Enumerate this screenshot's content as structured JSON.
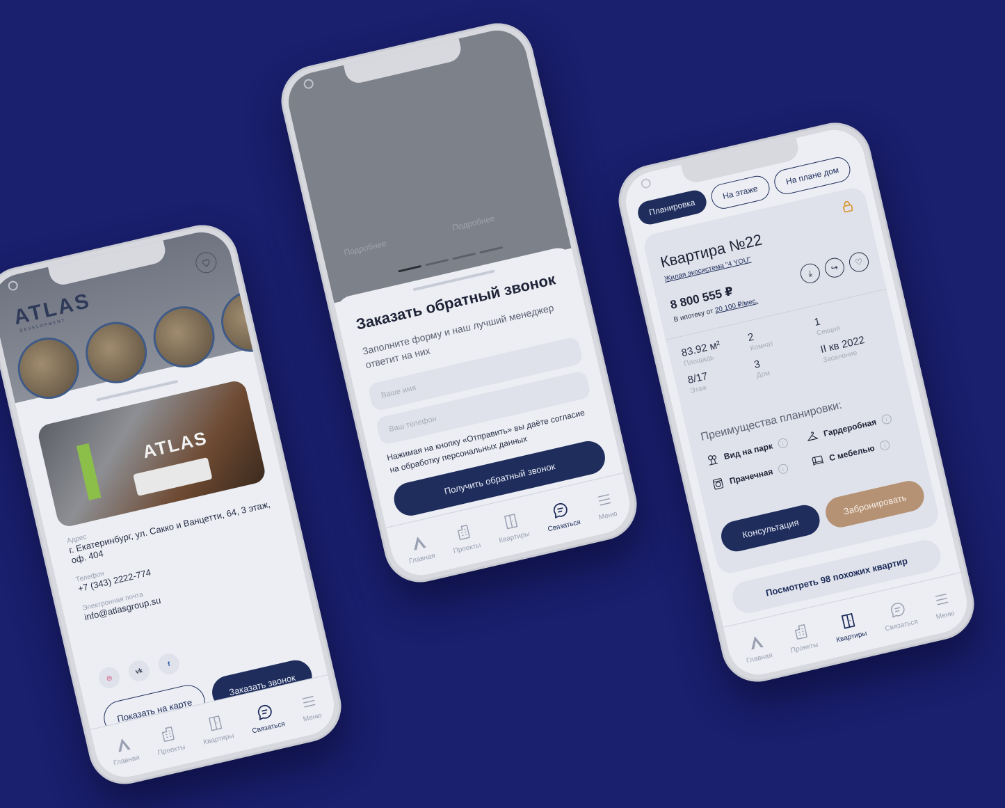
{
  "nav": {
    "home": "Главная",
    "projects": "Проекты",
    "apartments": "Квартиры",
    "contact": "Связаться",
    "menu": "Меню"
  },
  "phone1": {
    "logo": "ATLAS",
    "logo_sub": "DEVELOPMENT",
    "photo_sign": "ATLAS",
    "address_label": "Адрес",
    "address_value": "г. Екатеринбург, ул. Сакко и Ванцетти, 64, 3 этаж, оф. 404",
    "phone_label": "Телефон",
    "phone_value": "+7 (343) 2222-774",
    "email_label": "Электронная почта",
    "email_value": "info@atlasgroup.su",
    "socials": [
      "instagram-icon",
      "vk-icon",
      "facebook-icon"
    ],
    "show_map": "Показать на карте",
    "order_call": "Заказать звонок"
  },
  "phone2": {
    "more1": "Подробнее",
    "more2": "Подробнее",
    "title": "Заказать обратный звонок",
    "subtitle": "Заполните форму и наш лучший менеджер ответит на них",
    "name_placeholder": "Ваше имя",
    "phone_placeholder": "Ваш телефон",
    "consent": "Нажимая на кнопку «Отправить» вы даёте согласие на обработку персональных данных",
    "submit": "Получить обратный звонок"
  },
  "phone3": {
    "tabs": [
      "Планировка",
      "На этаже",
      "На плане дом"
    ],
    "title": "Квартира №22",
    "ecosystem": "Жилая экосистема \"4 YOU\"",
    "price": "8 800 555 ₽",
    "mortgage_prefix": "В ипотеку от",
    "mortgage_value": "20 100 ₽/мес.",
    "stats": [
      {
        "value": "83.92 м²",
        "label": "Площадь"
      },
      {
        "value": "2",
        "label": "Комнат"
      },
      {
        "value": "1",
        "label": "Секция"
      },
      {
        "value": "8/17",
        "label": "Этаж"
      },
      {
        "value": "3",
        "label": "Дом"
      },
      {
        "value": "II кв 2022",
        "label": "Заселение"
      }
    ],
    "advantages_title": "Преимущества планировки:",
    "advantages": [
      "Вид на парк",
      "Гардеробная",
      "Прачечная",
      "С мебелью"
    ],
    "consult": "Консультация",
    "book": "Забронировать",
    "similar": "Посмотреть 98 похожих квартир"
  },
  "colors": {
    "background": "#1a1f6e",
    "primary": "#1e2d5c",
    "accent": "#b69274",
    "screen": "#eceef3"
  }
}
